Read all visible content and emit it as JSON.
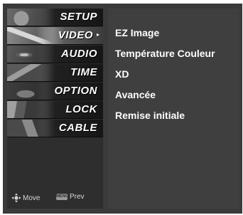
{
  "sidebar": {
    "items": [
      {
        "label": "SETUP",
        "thumb": "antenna-image"
      },
      {
        "label": "VIDEO",
        "thumb": "video-image",
        "selected": true
      },
      {
        "label": "AUDIO",
        "thumb": "speaker-image"
      },
      {
        "label": "TIME",
        "thumb": "clock-image"
      },
      {
        "label": "OPTION",
        "thumb": "option-image"
      },
      {
        "label": "LOCK",
        "thumb": "lock-image"
      },
      {
        "label": "CABLE",
        "thumb": "cable-image"
      }
    ],
    "selected_arrow": "▸"
  },
  "nav": {
    "move_label": "Move",
    "menu_key_label": "MENU",
    "prev_label": "Prev"
  },
  "submenu": {
    "items": [
      "EZ Image",
      "Température Couleur",
      "XD",
      "Avancée",
      "Remise initiale"
    ]
  }
}
